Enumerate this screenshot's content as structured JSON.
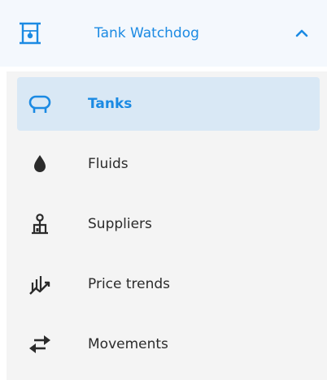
{
  "header": {
    "title": "Tank Watchdog",
    "icon": "tank-gauge-icon",
    "chevron": "chevron-up-icon",
    "expanded": true
  },
  "items": [
    {
      "label": "Tanks",
      "icon": "tank-icon",
      "active": true
    },
    {
      "label": "Fluids",
      "icon": "drop-icon",
      "active": false
    },
    {
      "label": "Suppliers",
      "icon": "supplier-icon",
      "active": false
    },
    {
      "label": "Price trends",
      "icon": "price-trend-icon",
      "active": false
    },
    {
      "label": "Movements",
      "icon": "swap-arrows-icon",
      "active": false
    }
  ],
  "colors": {
    "accent": "#1b8ae3",
    "header_bg": "#f4f8fd",
    "list_bg": "#f4f4f4",
    "active_bg": "#d9e8f5",
    "icon_dark": "#2b2b2b"
  }
}
